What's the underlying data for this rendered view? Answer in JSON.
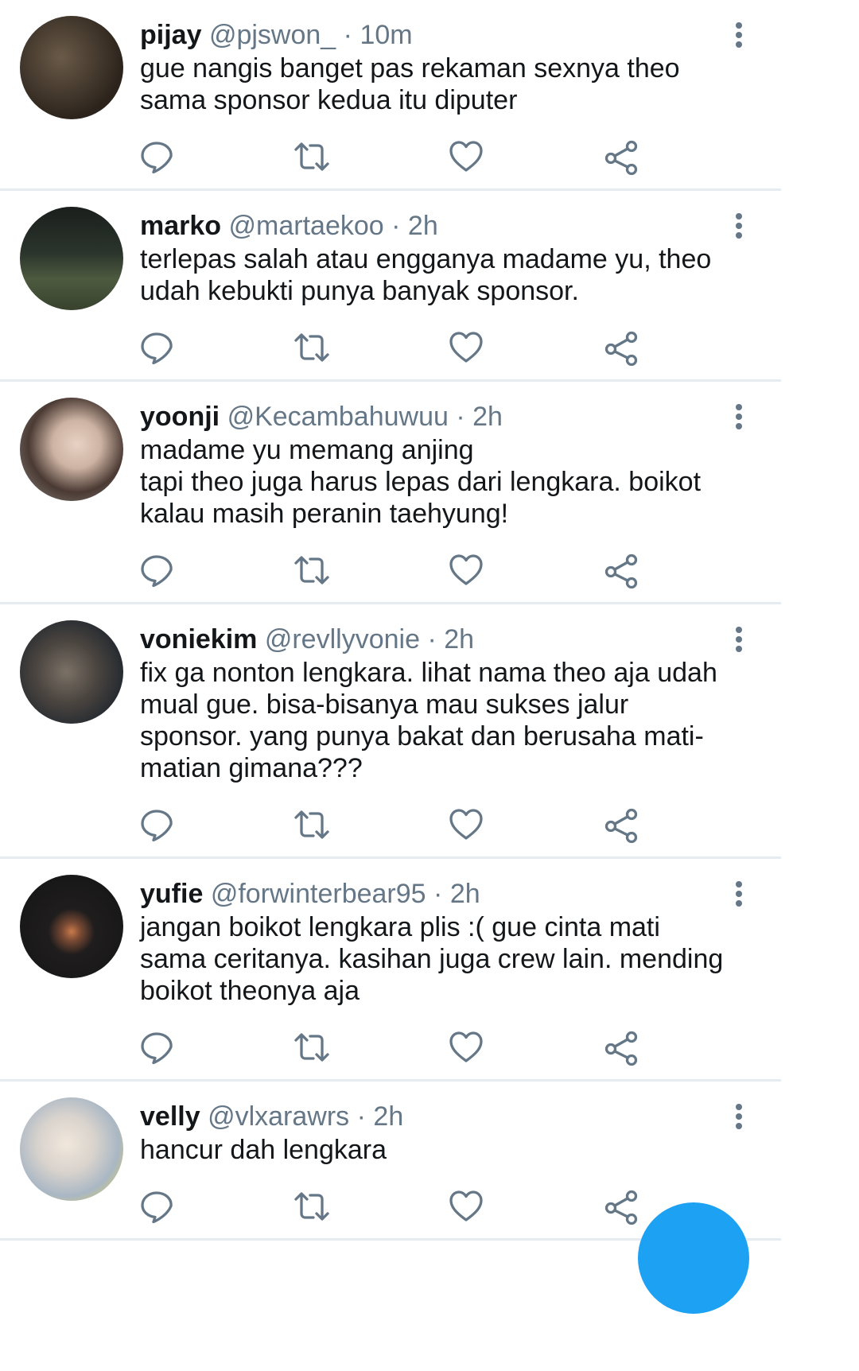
{
  "colors": {
    "accent": "#1da1f2",
    "text": "#14171a",
    "secondary": "#657786",
    "divider": "#e6ecf0"
  },
  "icons": {
    "reply": "speech-bubble-icon",
    "retweet": "retweet-icon",
    "like": "heart-icon",
    "share": "share-icon",
    "more": "vertical-ellipsis-icon"
  },
  "tweets": [
    {
      "name": "pijay",
      "handle": "@pjswon_",
      "time": "10m",
      "text": "gue nangis banget pas rekaman sexnya theo\nsama sponsor kedua itu diputer"
    },
    {
      "name": "marko",
      "handle": "@martaekoo",
      "time": "2h",
      "text": "terlepas salah atau engganya madame yu, theo\nudah kebukti punya banyak sponsor."
    },
    {
      "name": "yoonji",
      "handle": "@Kecambahuwuu",
      "time": "2h",
      "text": "madame yu memang anjing\ntapi theo juga harus lepas dari lengkara. boikot\nkalau masih peranin taehyung!"
    },
    {
      "name": "voniekim",
      "handle": "@revllyvonie",
      "time": "2h",
      "text": "fix ga nonton lengkara. lihat nama theo aja udah\nmual gue. bisa-bisanya mau sukses jalur\nsponsor. yang punya bakat dan berusaha mati-\nmatian gimana???"
    },
    {
      "name": "yufie",
      "handle": "@forwinterbear95",
      "time": "2h",
      "text": "jangan boikot lengkara plis :( gue cinta mati\nsama ceritanya. kasihan juga crew lain. mending\nboikot theonya aja"
    },
    {
      "name": "velly",
      "handle": "@vlxarawrs",
      "time": "2h",
      "text": "hancur dah lengkara"
    }
  ]
}
